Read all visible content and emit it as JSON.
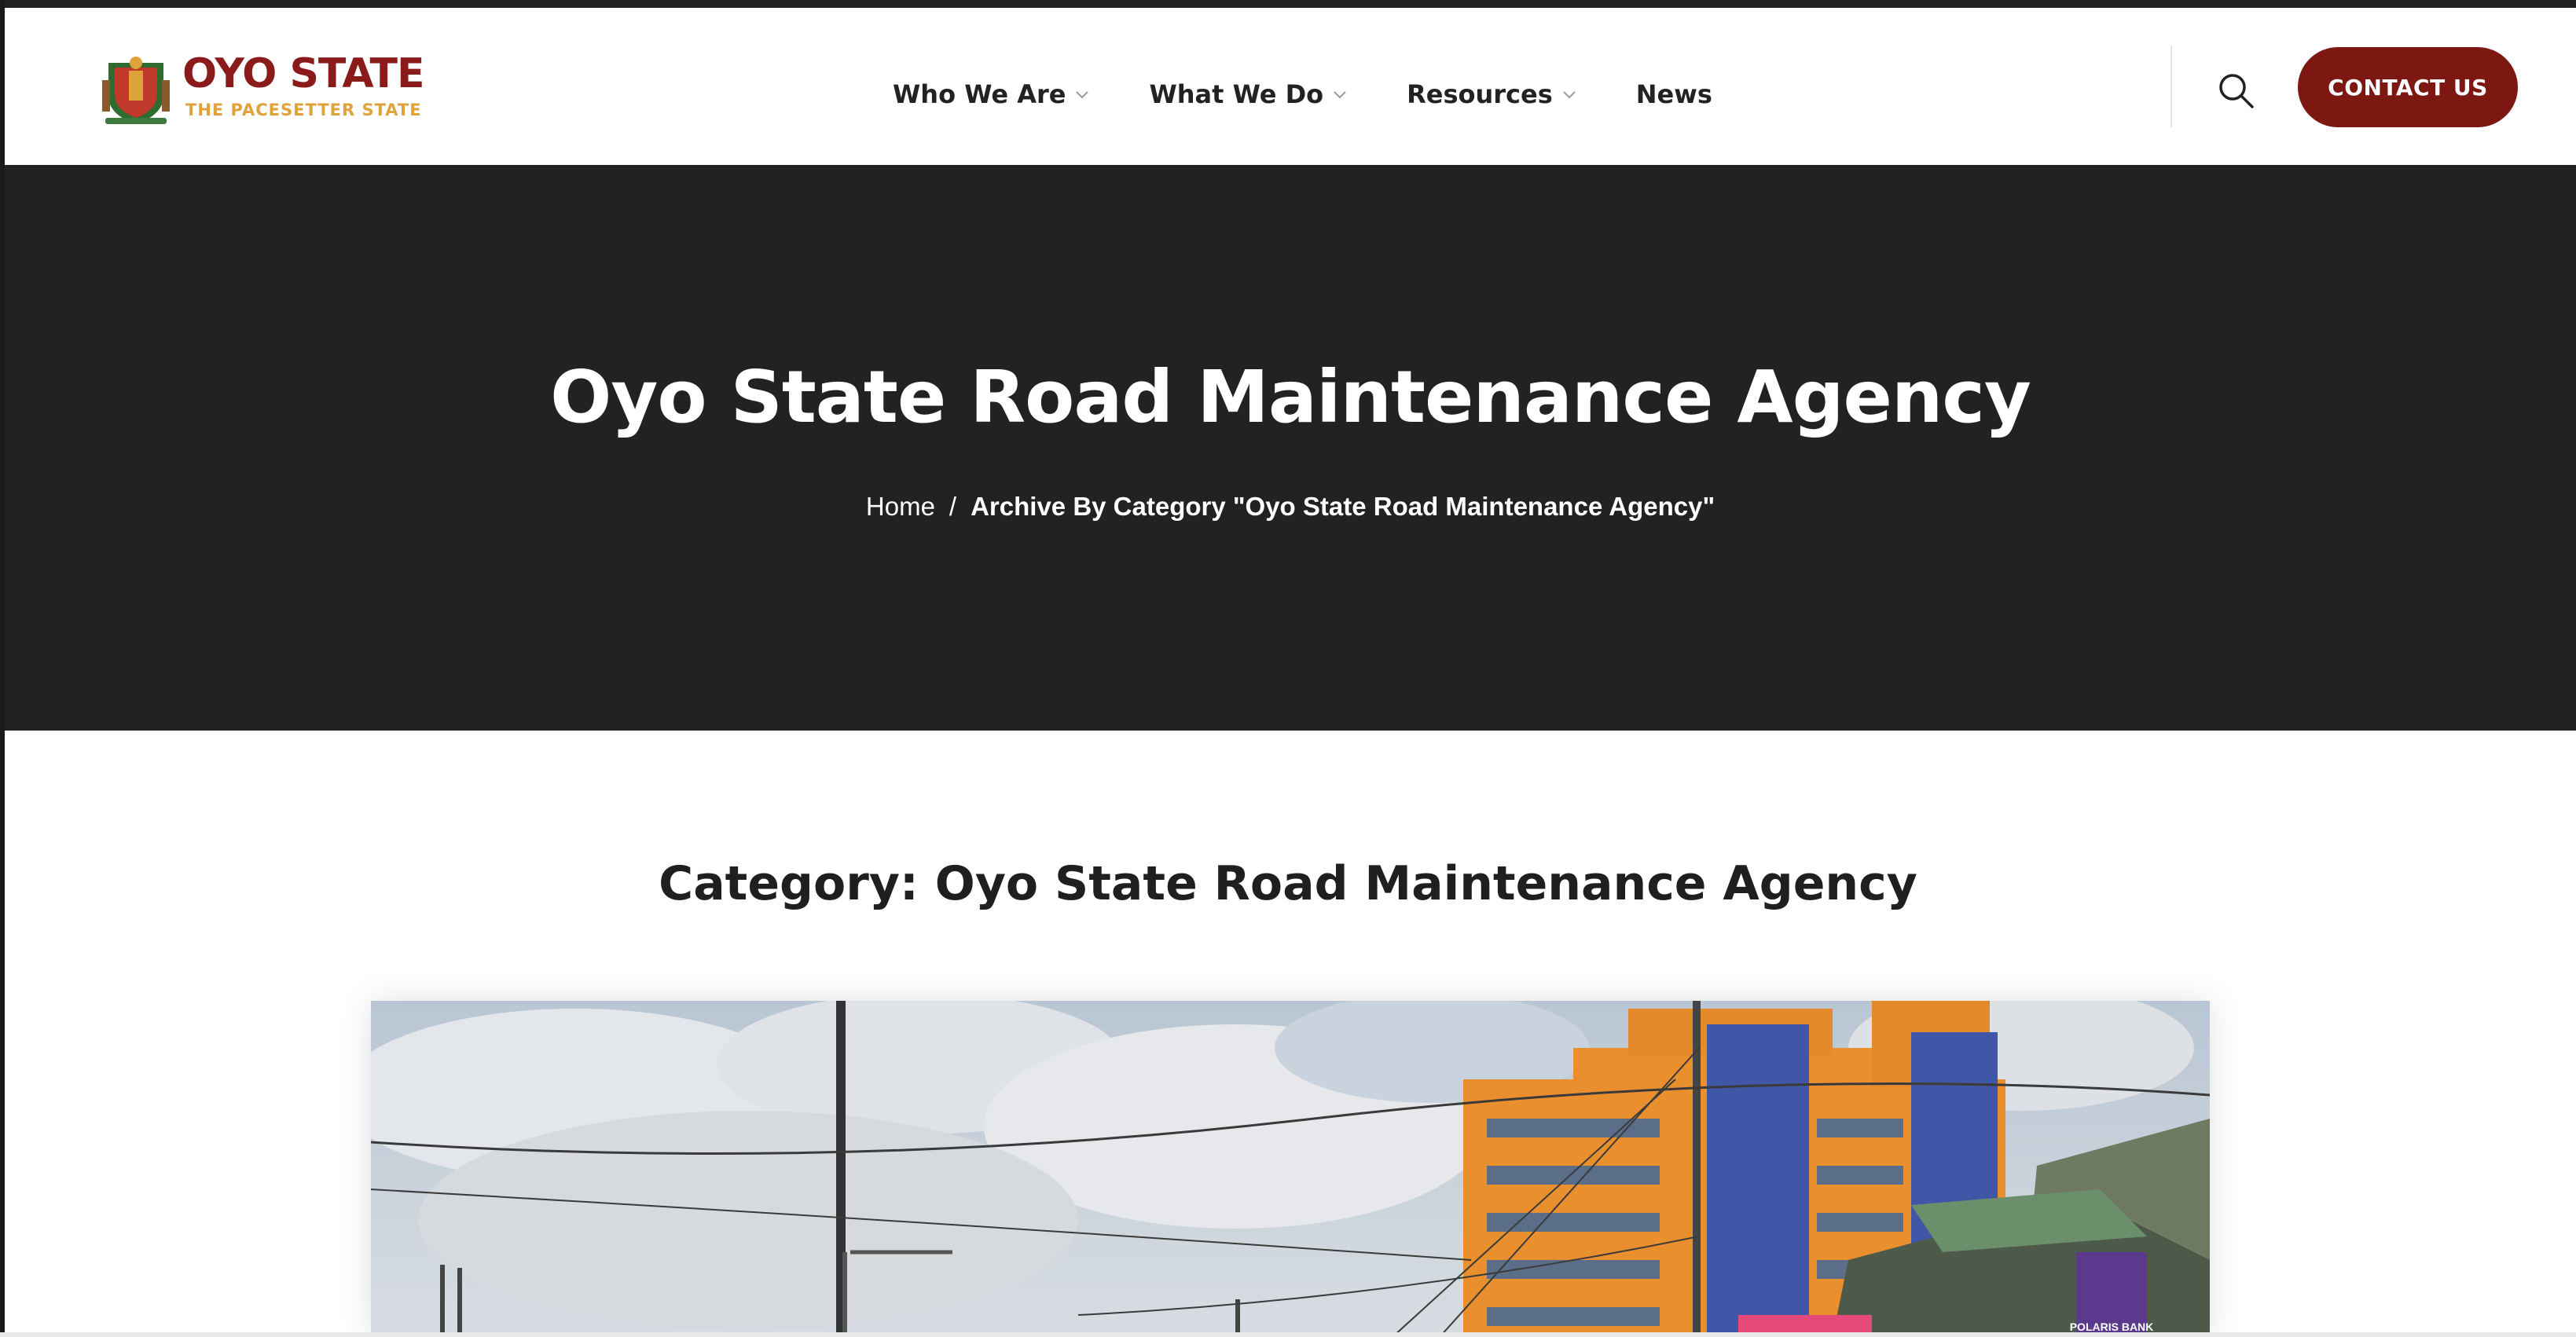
{
  "brand": {
    "name": "OYO STATE",
    "tagline": "THE PACESETTER STATE",
    "colors": {
      "primary": "#7d1712",
      "accent": "#e0a23a"
    },
    "logo_icon": "state-crest-icon"
  },
  "nav": {
    "items": [
      {
        "label": "Who We Are",
        "has_dropdown": true
      },
      {
        "label": "What We Do",
        "has_dropdown": true
      },
      {
        "label": "Resources",
        "has_dropdown": true
      },
      {
        "label": "News",
        "has_dropdown": false
      }
    ],
    "search_icon": "search-icon",
    "contact_label": "CONTACT US"
  },
  "hero": {
    "title": "Oyo State Road Maintenance Agency",
    "breadcrumb": {
      "home": "Home",
      "separator": "/",
      "current": "Archive By Category \"Oyo State Road Maintenance Agency\""
    },
    "background": "#222222"
  },
  "main": {
    "category_title": "Category: Oyo State Road Maintenance Agency",
    "post_image": "street-photo"
  },
  "photo_text": {
    "bank_sign": "POLARIS BANK"
  }
}
